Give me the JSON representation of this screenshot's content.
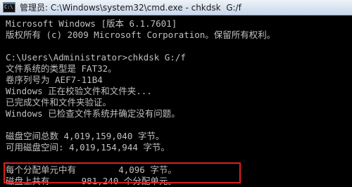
{
  "window": {
    "icon": "cmd-icon",
    "icon_prompt": "C:\\",
    "title": "管理员: C:\\Windows\\system32\\cmd.exe - chkdsk  G:/f"
  },
  "console": {
    "lines": [
      "Microsoft Windows [版本 6.1.7601]",
      "版权所有 (c) 2009 Microsoft Corporation。保留所有权利。",
      "",
      "C:\\Users\\Administrator>chkdsk G:/f",
      "文件系统的类型是 FAT32。",
      "卷序列号为 AEF7-11B4",
      "Windows 正在校验文件和文件夹...",
      "已完成文件和文件夹验证。",
      "Windows 已检查文件系统并确定没有问题。",
      "",
      "磁盘空间总数 4,019,159,040 字节。",
      "可用磁盘空间: 4,019,154,944 字节。",
      "",
      "每个分配单元中有        4,096 字节。",
      "磁盘上共有      981,240 个分配单元。"
    ]
  },
  "colors": {
    "console_bg": "#000000",
    "console_text": "#c0c0c0",
    "highlight_border": "#e21d1d"
  }
}
